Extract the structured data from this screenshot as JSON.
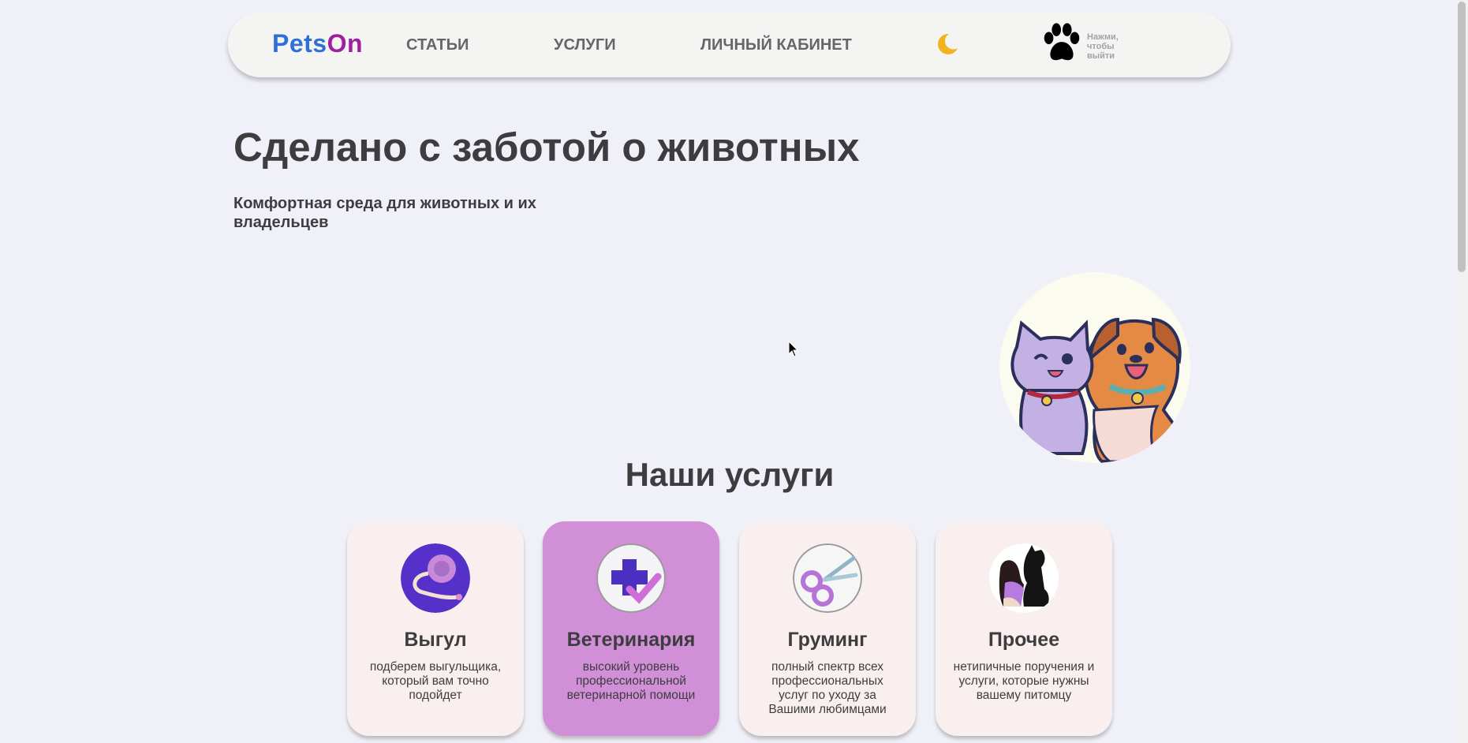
{
  "nav": {
    "logo_part1": "Pets",
    "logo_part2": "On",
    "links": [
      "СТАТЬИ",
      "УСЛУГИ",
      "ЛИЧНЫЙ КАБИНЕТ"
    ],
    "theme_icon": "moon-icon",
    "profile_icon": "paw-icon",
    "logout_hint": "Нажми, чтобы выйти"
  },
  "hero": {
    "title": "Сделано с заботой о животных",
    "subtitle": "Комфортная среда для животных и их владельцев",
    "image": "cat-and-dog-illustration"
  },
  "services": {
    "title": "Наши услуги",
    "cards": [
      {
        "name": "Выгул",
        "desc": "подберем выгульщика, который вам точно подойдет",
        "icon": "leash-icon"
      },
      {
        "name": "Ветеринария",
        "desc": "высокий уровень профессиональной ветеринарной помощи",
        "icon": "medical-cross-icon"
      },
      {
        "name": "Груминг",
        "desc": "полный спектр всех профессиональных услуг по уходу за Вашими любимцами",
        "icon": "scissors-icon"
      },
      {
        "name": "Прочее",
        "desc": "нетипичные поручения и услуги, которые нужны вашему питомцу",
        "icon": "pets-silhouette-icon"
      }
    ]
  },
  "colors": {
    "background": "#f0f0f9",
    "navbar": "#f4f5f3",
    "logo_blue": "#2f6fd6",
    "logo_purple": "#a01fa0",
    "card": "#faefef",
    "card_active": "#d18fd8",
    "text": "#3d3d3f"
  }
}
